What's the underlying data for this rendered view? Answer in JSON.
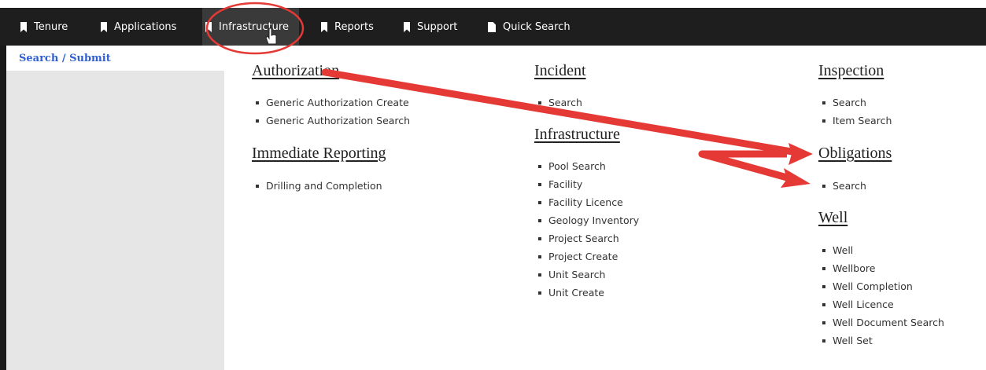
{
  "nav": {
    "items": [
      {
        "label": "Tenure",
        "icon": "bookmark-icon"
      },
      {
        "label": "Applications",
        "icon": "bookmark-icon"
      },
      {
        "label": "Infrastructure",
        "icon": "bookmark-icon",
        "active": true
      },
      {
        "label": "Reports",
        "icon": "bookmark-icon"
      },
      {
        "label": "Support",
        "icon": "bookmark-icon"
      },
      {
        "label": "Quick Search",
        "icon": "document-icon"
      }
    ]
  },
  "sidebar": {
    "link": "Search / Submit"
  },
  "sections": {
    "authorization": {
      "title": "Authorization",
      "items": [
        "Generic Authorization Create",
        "Generic Authorization Search"
      ]
    },
    "immediate_reporting": {
      "title": "Immediate Reporting",
      "items": [
        "Drilling and Completion"
      ]
    },
    "incident": {
      "title": "Incident",
      "items": [
        "Search"
      ]
    },
    "infrastructure": {
      "title": "Infrastructure",
      "items": [
        "Pool Search",
        "Facility",
        "Facility Licence",
        "Geology Inventory",
        "Project Search",
        "Project Create",
        "Unit Search",
        "Unit Create"
      ]
    },
    "inspection": {
      "title": "Inspection",
      "items": [
        "Search",
        "Item Search"
      ]
    },
    "obligations": {
      "title": "Obligations",
      "items": [
        "Search"
      ]
    },
    "well": {
      "title": "Well",
      "items": [
        "Well",
        "Wellbore",
        "Well Completion",
        "Well Licence",
        "Well Document Search",
        "Well Set"
      ]
    }
  },
  "colors": {
    "navbar": "#1e1e1e",
    "sidebar": "#e6e6e6",
    "link": "#2f5fd0",
    "annotation": "#e53935"
  }
}
